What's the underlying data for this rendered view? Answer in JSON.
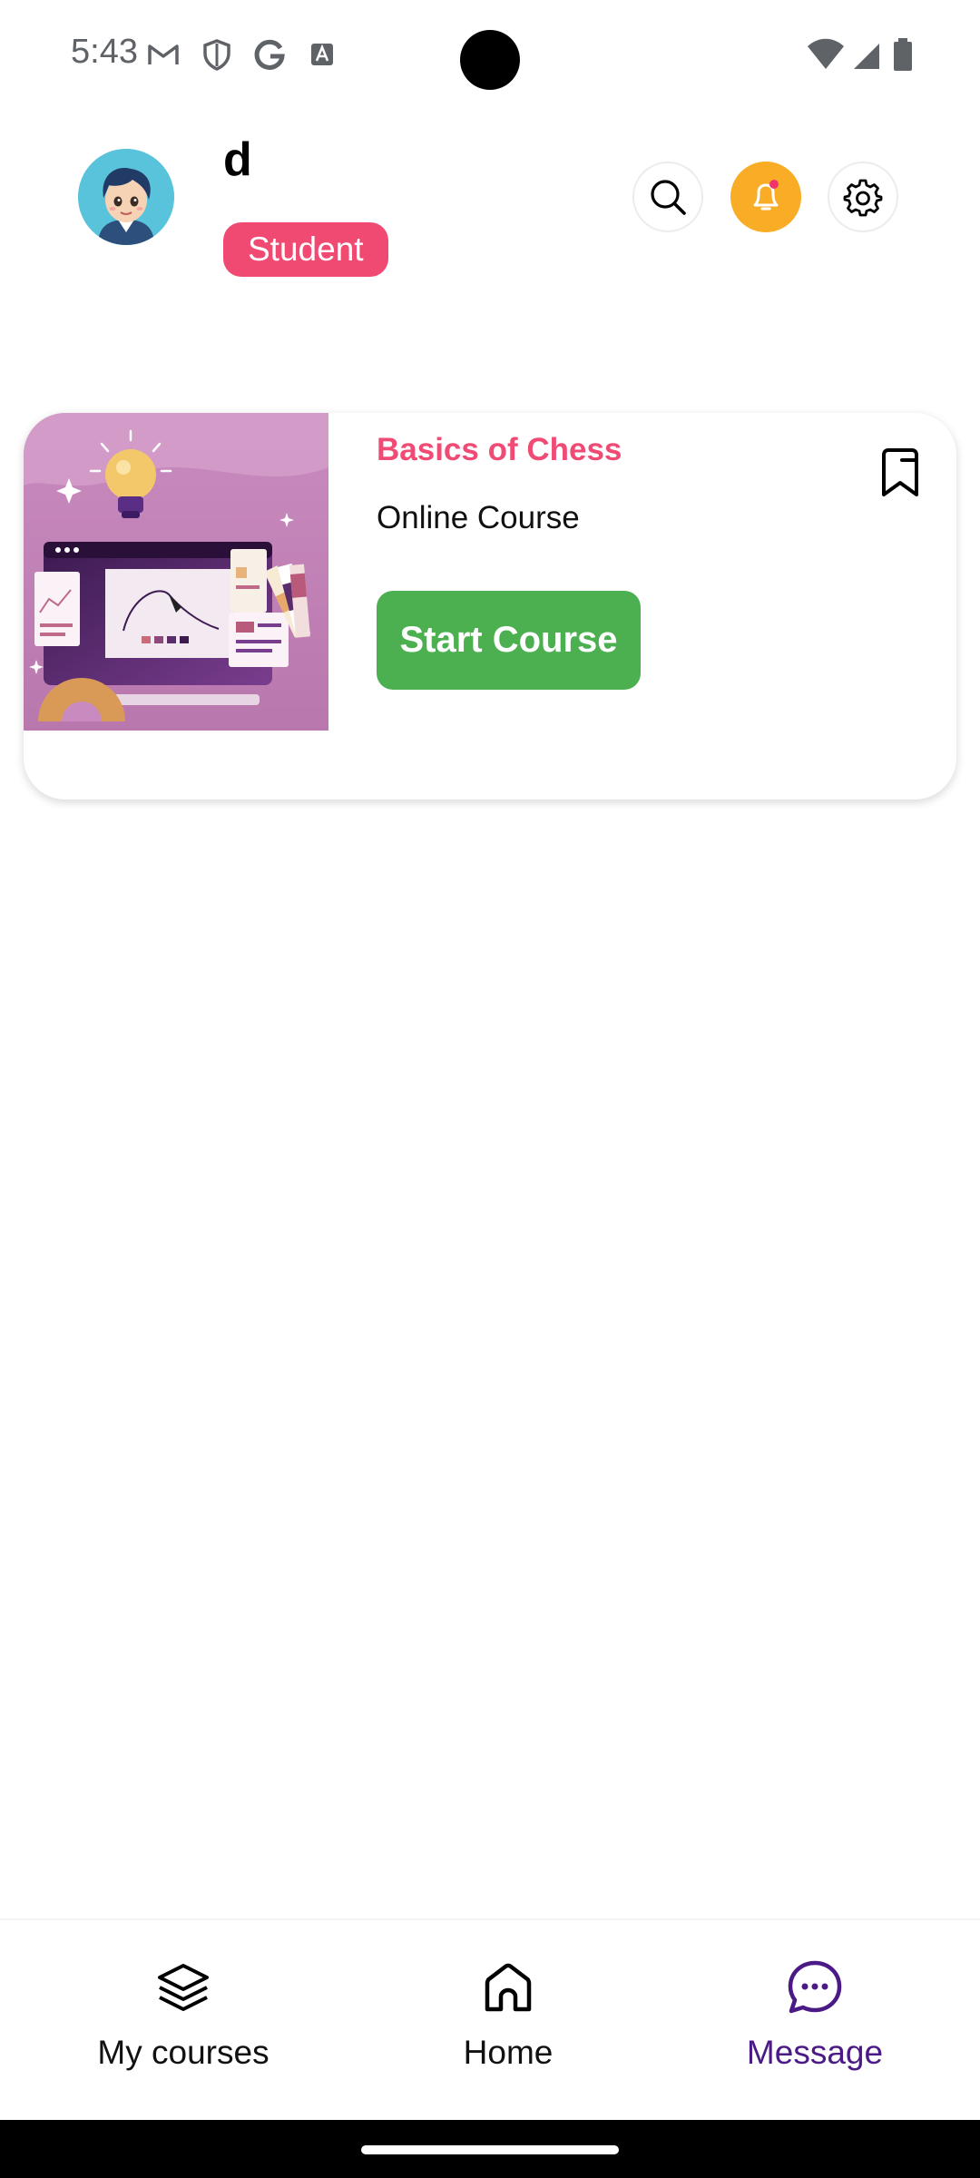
{
  "status_bar": {
    "time": "5:43",
    "left_icons": [
      "gmail-icon",
      "shield-icon",
      "google-icon",
      "font-icon"
    ],
    "right_icons": [
      "wifi-icon",
      "signal-icon",
      "battery-icon"
    ]
  },
  "header": {
    "user_name": "d",
    "role": "Student",
    "actions": [
      "search-icon",
      "bell-icon",
      "gear-icon"
    ]
  },
  "course": {
    "title": "Basics of Chess",
    "type": "Online Course",
    "button_label": "Start Course",
    "bookmark_icon": "bookmark-icon"
  },
  "nav": {
    "items": [
      {
        "label": "My courses",
        "icon": "layers-icon",
        "active": false
      },
      {
        "label": "Home",
        "icon": "home-icon",
        "active": false
      },
      {
        "label": "Message",
        "icon": "chat-icon",
        "active": true
      }
    ]
  },
  "colors": {
    "badge": "#f04a72",
    "title_accent": "#ef4b74",
    "start_button": "#4caf50",
    "notification": "#f9ad27",
    "active_nav": "#4b1a86"
  }
}
